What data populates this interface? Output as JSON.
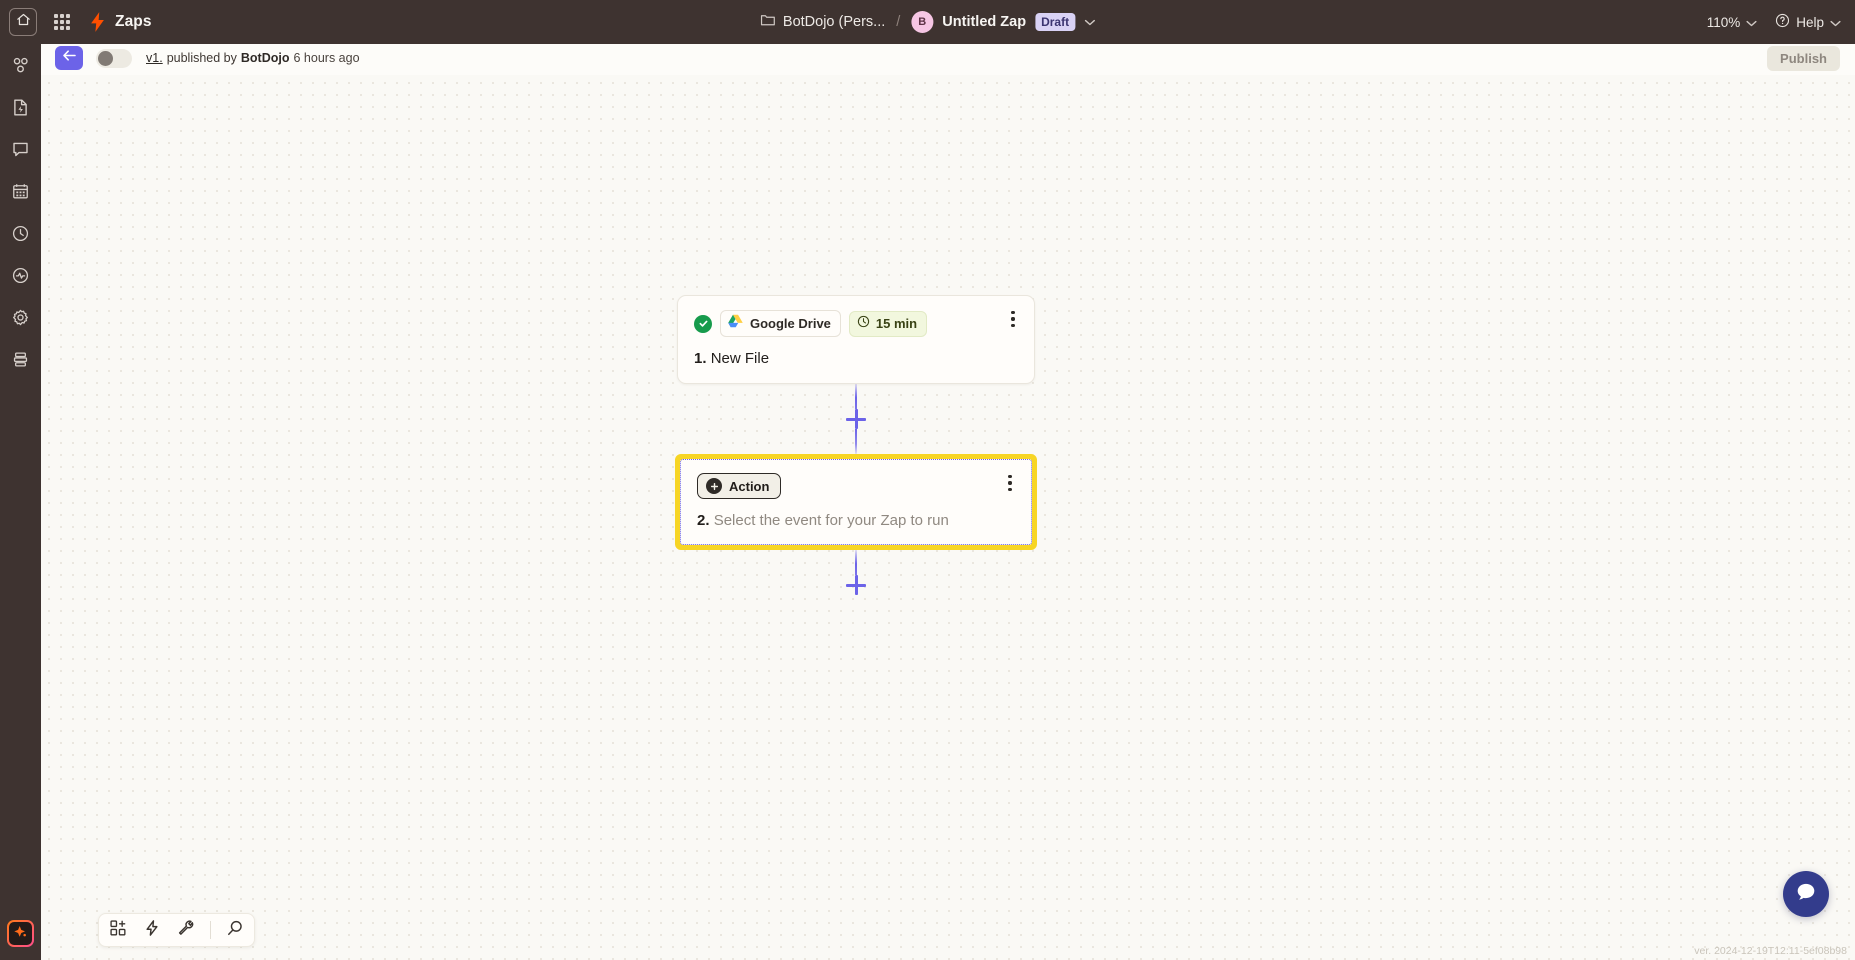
{
  "topbar": {
    "home_icon": "home-icon",
    "apps_icon": "app-grid-icon",
    "logo_icon": "zapier-bolt-icon",
    "app_title": "Zaps",
    "folder_icon": "folder-icon",
    "folder_name": "BotDojo (Pers...",
    "separator": "/",
    "avatar_initial": "B",
    "zap_name": "Untitled Zap",
    "status_badge": "Draft",
    "zoom_level": "110%",
    "help_label": "Help",
    "help_icon": "question-circle-icon",
    "chevron_icon": "chevron-down-icon"
  },
  "rail": {
    "items": [
      {
        "icon": "nodes-icon",
        "name": "sidebar-item-zaps"
      },
      {
        "icon": "file-bolt-icon",
        "name": "sidebar-item-templates"
      },
      {
        "icon": "chat-bubble-icon",
        "name": "sidebar-item-chatbots"
      },
      {
        "icon": "table-icon",
        "name": "sidebar-item-tables"
      },
      {
        "icon": "clock-icon",
        "name": "sidebar-item-history"
      },
      {
        "icon": "activity-icon",
        "name": "sidebar-item-monitoring"
      },
      {
        "icon": "gear-icon",
        "name": "sidebar-item-settings"
      },
      {
        "icon": "database-icon",
        "name": "sidebar-item-storage"
      }
    ],
    "ai_button_icon": "ai-sparkle-icon"
  },
  "subheader": {
    "back_icon": "back-arrow-icon",
    "toggle_state": "off",
    "version_label": "v1.",
    "published_by_text": "published by",
    "author": "BotDojo",
    "time_ago": "6 hours ago",
    "publish_label": "Publish"
  },
  "flow": {
    "trigger": {
      "status_icon": "check-circle-icon",
      "app_icon": "google-drive-icon",
      "app_name": "Google Drive",
      "schedule_icon": "clock-icon",
      "schedule_label": "15 min",
      "menu_icon": "kebab-menu-icon",
      "step_number": "1.",
      "title": "New File"
    },
    "action": {
      "chip_icon": "action-plus-icon",
      "chip_label": "Action",
      "menu_icon": "kebab-menu-icon",
      "step_number": "2.",
      "title": "Select the event for your Zap to run",
      "selected": true
    },
    "add_step_icon": "plus-icon"
  },
  "bottom_tools": {
    "items": [
      {
        "icon": "add-app-icon",
        "name": "toolbar-add-app"
      },
      {
        "icon": "bolt-icon",
        "name": "toolbar-actions"
      },
      {
        "icon": "wrench-icon",
        "name": "toolbar-tools"
      },
      {
        "icon": "search-icon",
        "name": "toolbar-search"
      }
    ]
  },
  "footer": {
    "chat_icon": "chat-support-icon",
    "version_text": "ver. 2024-12-19T12:11-5ef08b98"
  },
  "colors": {
    "topbar_bg": "#3E3330",
    "canvas_bg": "#FAF9F5",
    "accent_purple": "#6C63E8",
    "brand_orange": "#FF4F00",
    "selected_yellow": "#F7D524",
    "success_green": "#179B4C",
    "draft_badge_bg": "#D9D2F5"
  }
}
